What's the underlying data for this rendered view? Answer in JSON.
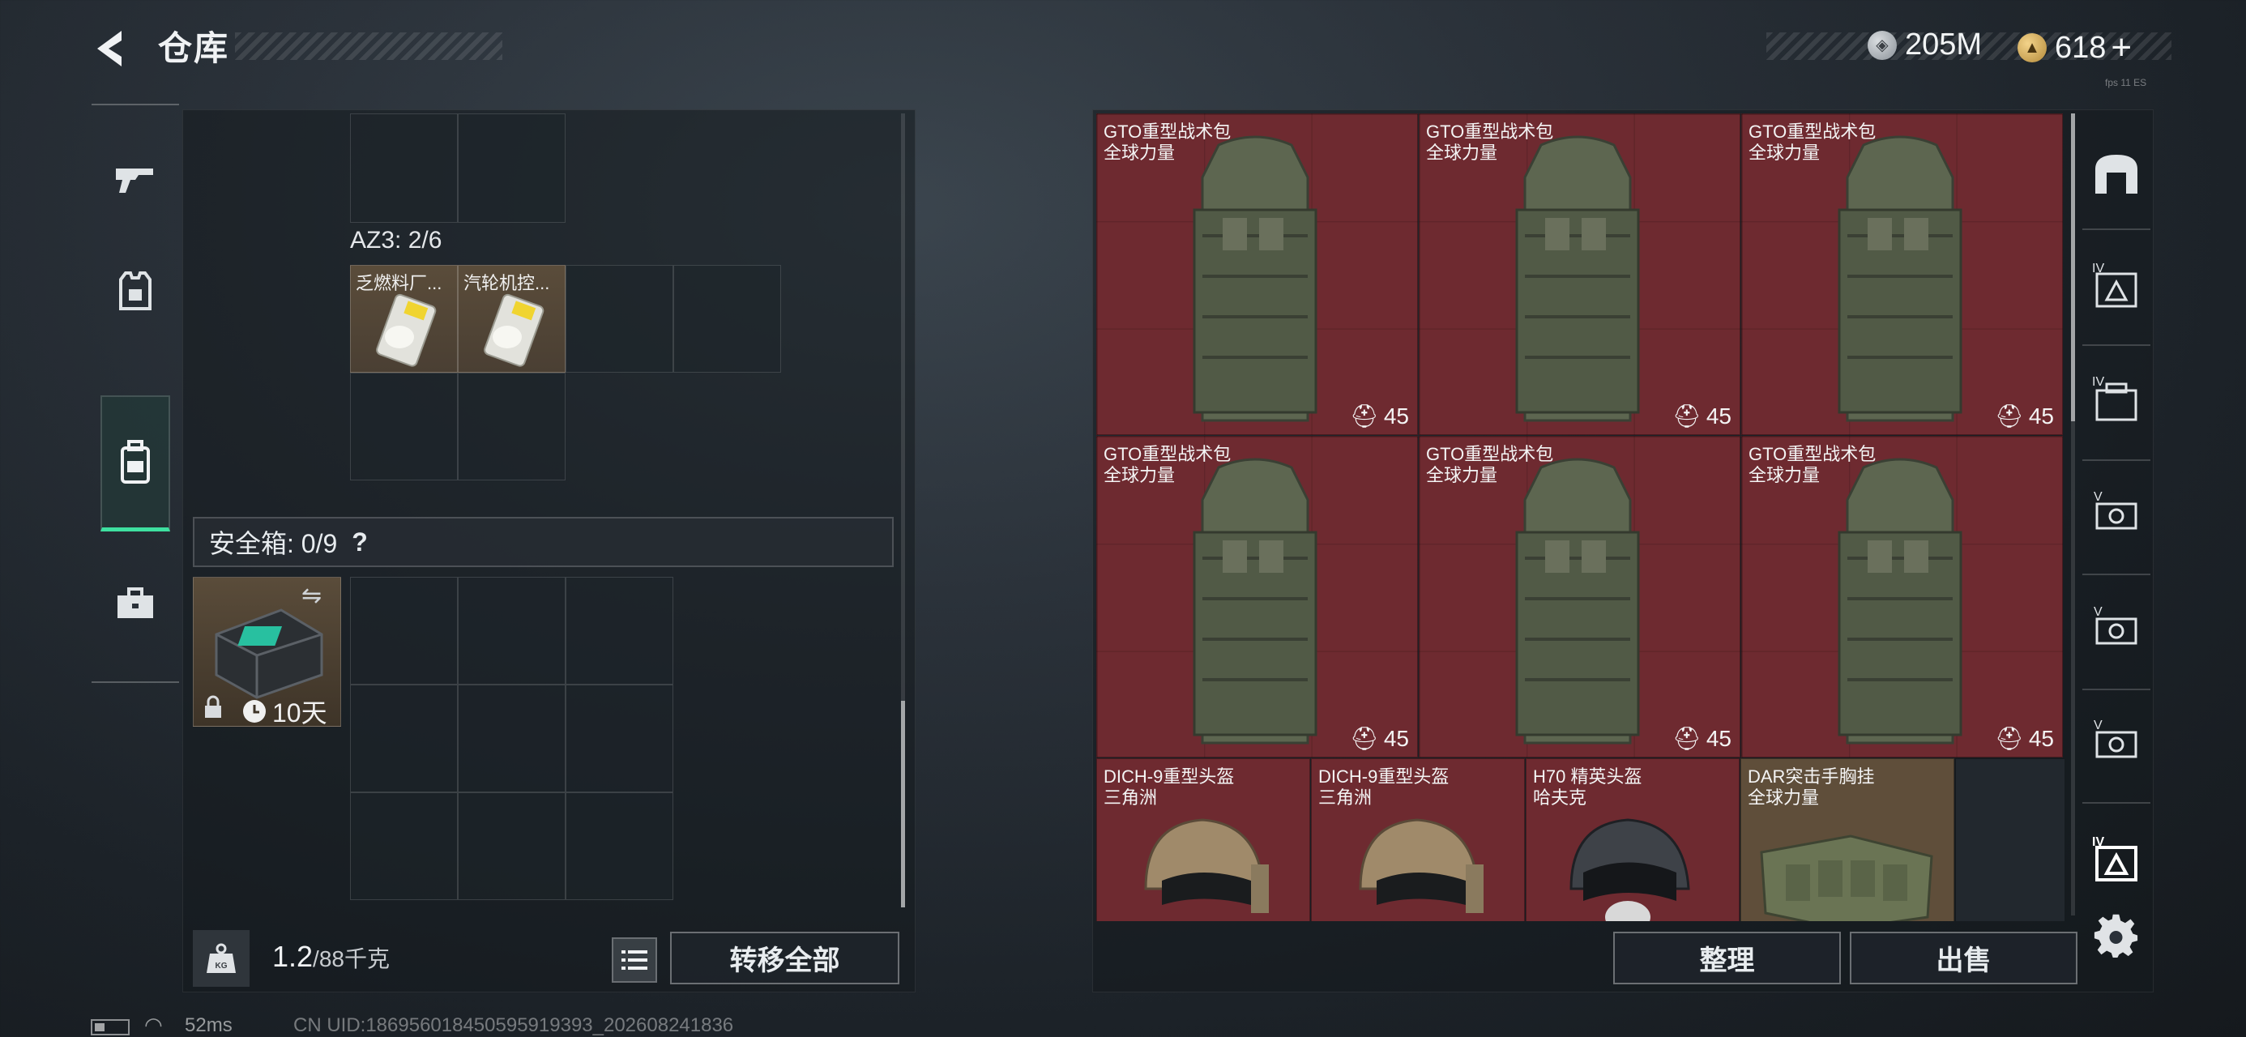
{
  "header": {
    "title": "仓库",
    "currency_silver": "205M",
    "currency_gold": "618",
    "gold_plus": "+",
    "version": "fps 11 ES"
  },
  "left_rail": {
    "items": [
      "gun",
      "armor",
      "backpack",
      "toolbox"
    ],
    "active": "backpack"
  },
  "storage": {
    "az3_label": "AZ3: 2/6",
    "items": [
      {
        "name": "乏燃料厂..."
      },
      {
        "name": "汽轮机控..."
      }
    ],
    "safebox_label": "安全箱: 0/9",
    "safebox_help": "?",
    "safebox_timer": "10天"
  },
  "bottom_left": {
    "weight_current": "1.2",
    "weight_max": "/88千克",
    "weight_icon": "KG",
    "transfer_all": "转移全部"
  },
  "inventory": {
    "backpacks": [
      {
        "name": "GTO重型战术包",
        "faction": "全球力量",
        "capacity": "45"
      },
      {
        "name": "GTO重型战术包",
        "faction": "全球力量",
        "capacity": "45"
      },
      {
        "name": "GTO重型战术包",
        "faction": "全球力量",
        "capacity": "45"
      },
      {
        "name": "GTO重型战术包",
        "faction": "全球力量",
        "capacity": "45"
      },
      {
        "name": "GTO重型战术包",
        "faction": "全球力量",
        "capacity": "45"
      },
      {
        "name": "GTO重型战术包",
        "faction": "全球力量",
        "capacity": "45"
      }
    ],
    "small_items": [
      {
        "name": "DICH-9重型头盔",
        "faction": "三角洲"
      },
      {
        "name": "DICH-9重型头盔",
        "faction": "三角洲"
      },
      {
        "name": "H70 精英头盔",
        "faction": "哈夫克"
      },
      {
        "name": "DAR突击手胸挂",
        "faction": "全球力量"
      }
    ]
  },
  "actions": {
    "sort": "整理",
    "sell": "出售"
  },
  "right_rail": {
    "items": [
      "arch-filter",
      "tier4-kit",
      "tier4-case",
      "tier5-ticket-1",
      "tier5-ticket-2",
      "tier5-ticket-3",
      "tier4-kit-2"
    ]
  },
  "status": {
    "ping": "52ms",
    "uid": "CN UID:1869560184505959193​93_202608241836"
  },
  "colors": {
    "accent": "#3ee0a0",
    "red_item": "#6e2a30",
    "brown_item": "#5f4e3a"
  }
}
